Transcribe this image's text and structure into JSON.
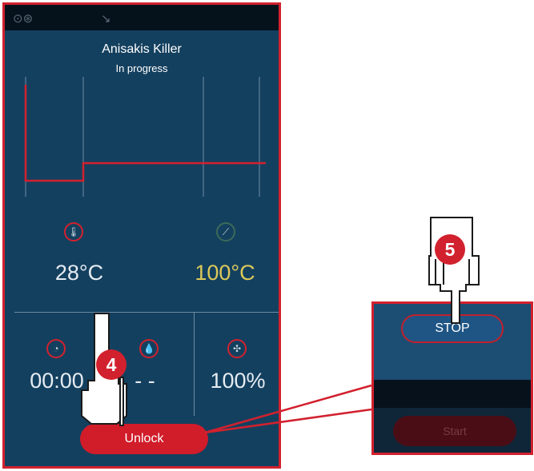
{
  "status_bar": {
    "icons": [
      "oven-fan-icon",
      "sound-mute-icon"
    ]
  },
  "header": {
    "title": "Anisakis Killer",
    "status": "In progress"
  },
  "temperatures": {
    "current": "28°C",
    "target": "100°C"
  },
  "metrics": {
    "time": "00:00",
    "humidity": "- -",
    "fan_speed": "100%"
  },
  "buttons": {
    "unlock": "Unlock"
  },
  "inset": {
    "stop": "STOP",
    "start": "Start"
  },
  "steps": {
    "step4": "4",
    "step5": "5"
  },
  "colors": {
    "accent": "#d2212e",
    "screen_bg": "#14405f",
    "target_text": "#dcc95a"
  }
}
